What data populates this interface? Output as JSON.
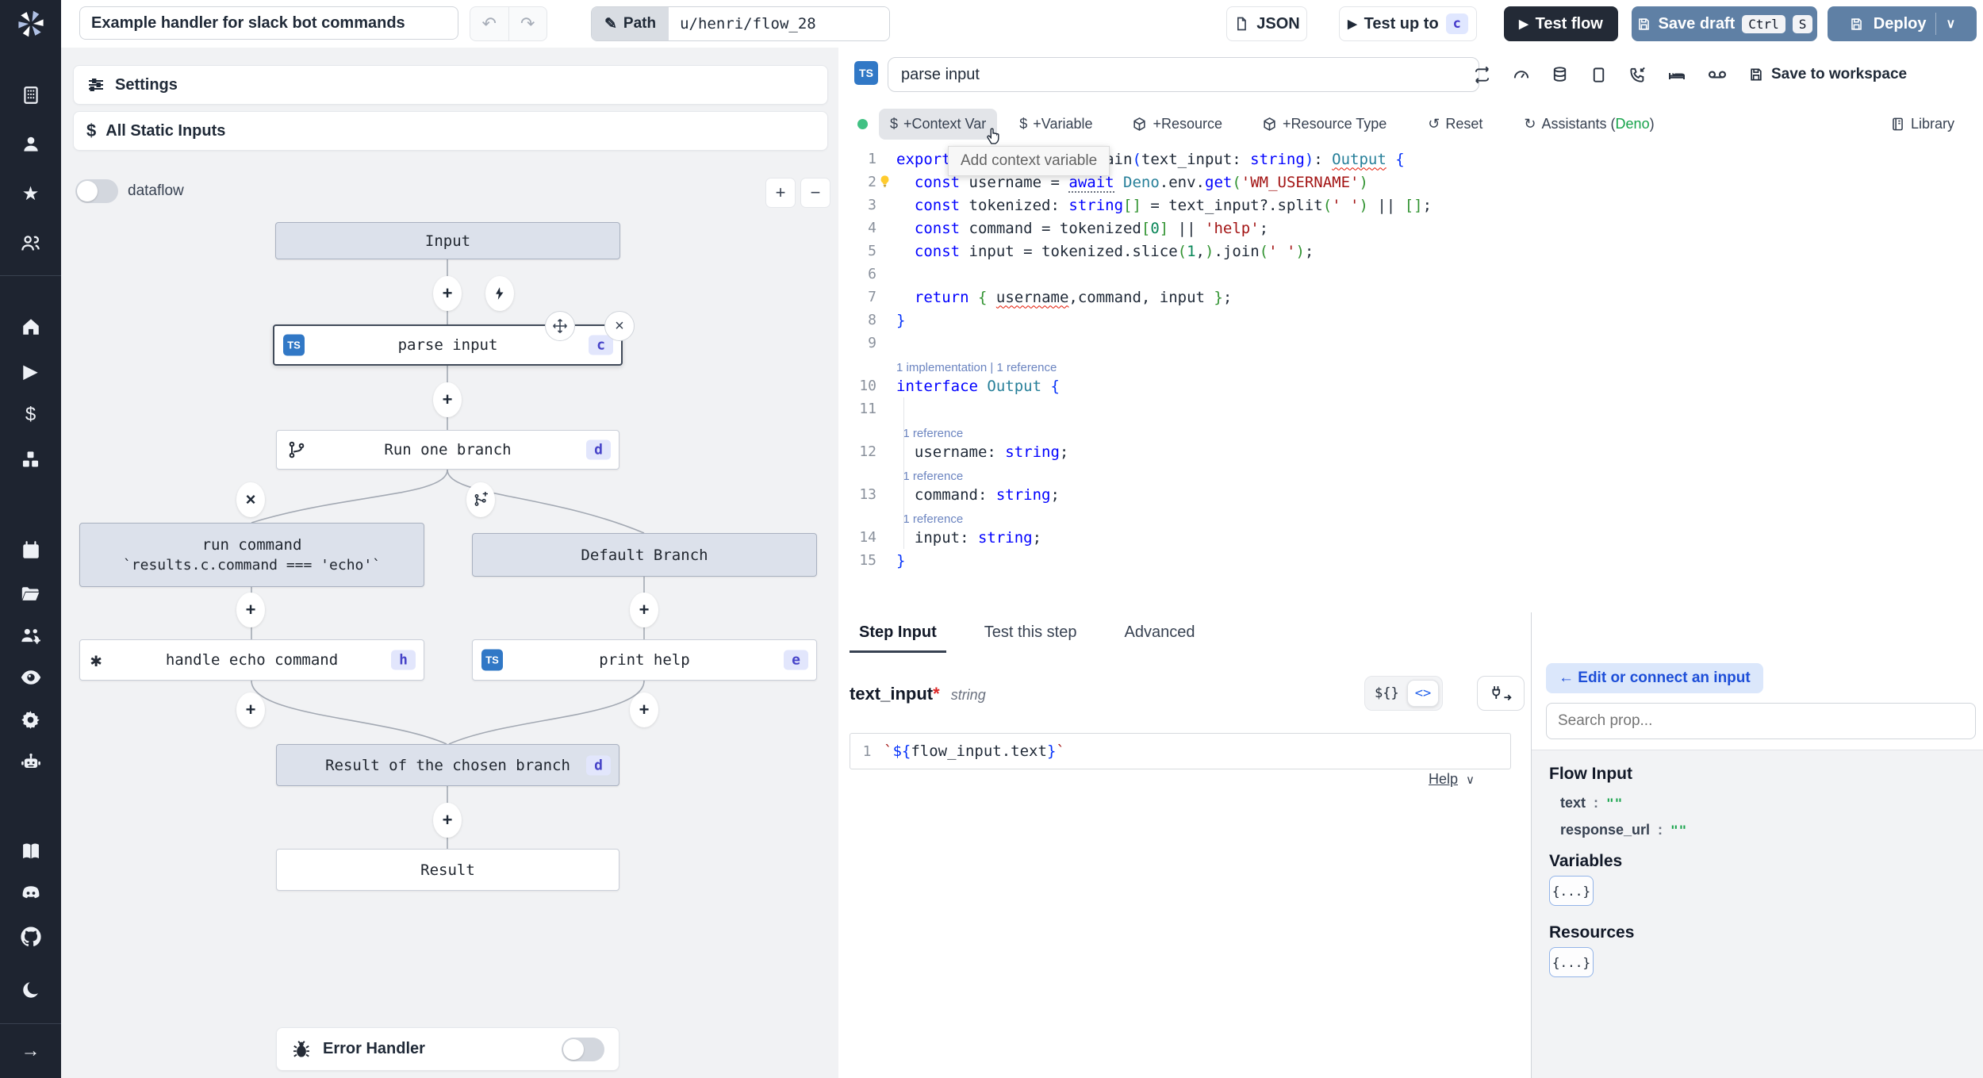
{
  "topbar": {
    "title_value": "Example handler for slack bot commands",
    "path_label": "Path",
    "path_value": "u/henri/flow_28",
    "json_label": "JSON",
    "test_up_to_label": "Test up to",
    "test_up_to_step": "c",
    "test_flow_label": "Test flow",
    "save_draft_label": "Save draft",
    "kbd_ctrl": "Ctrl",
    "kbd_s": "S",
    "deploy_label": "Deploy"
  },
  "flow": {
    "settings_label": "Settings",
    "static_inputs_label": "All Static Inputs",
    "dataflow_label": "dataflow",
    "zoom_in_label": "+",
    "zoom_out_label": "−",
    "input_node": "Input",
    "parse_input": {
      "lang": "TS",
      "label": "parse input",
      "badge": "c"
    },
    "run_one_branch": {
      "label": "Run one branch",
      "badge": "d"
    },
    "run_command": {
      "title": "run command",
      "condition": "`results.c.command === 'echo'`"
    },
    "default_branch": "Default Branch",
    "handle_echo": {
      "label": "handle echo command",
      "badge": "h"
    },
    "print_help": {
      "lang": "TS",
      "label": "print help",
      "badge": "e"
    },
    "result_branch": {
      "label": "Result of the chosen branch",
      "badge": "d"
    },
    "result_node": "Result",
    "error_handler_label": "Error Handler"
  },
  "editor": {
    "lang_badge": "TS",
    "step_name_value": "parse input",
    "save_to_workspace_label": "Save to workspace",
    "add_context_var": "+Context Var",
    "add_variable": "+Variable",
    "add_resource": "+Resource",
    "add_resource_type": "+Resource Type",
    "reset_label": "Reset",
    "assistants_prefix": "Assistants (",
    "assistants_lang": "Deno",
    "assistants_suffix": ")",
    "library_label": "Library",
    "tooltip": "Add context variable",
    "code": [
      {
        "l": "1",
        "t": [
          [
            "kw",
            "export "
          ],
          [
            "kw",
            "async "
          ],
          [
            "kw",
            "function "
          ],
          [
            "pl",
            "main"
          ],
          [
            "b1",
            "("
          ],
          [
            "pl",
            "text_input"
          ],
          [
            "pl",
            ": "
          ],
          [
            "kw",
            "string"
          ],
          [
            "b1",
            ")"
          ],
          [
            "pl",
            ": "
          ],
          [
            "typesq",
            "Output"
          ],
          [
            "pl",
            " "
          ],
          [
            "b1",
            "{"
          ]
        ]
      },
      {
        "l": "2",
        "bulb": true,
        "t": [
          [
            "pl",
            "  "
          ],
          [
            "kw",
            "const "
          ],
          [
            "pl",
            "username"
          ],
          [
            "pl",
            " = "
          ],
          [
            "kwdots",
            "await"
          ],
          [
            "pl",
            " "
          ],
          [
            "type",
            "Deno"
          ],
          [
            "pl",
            ".env."
          ],
          [
            "kw",
            "get"
          ],
          [
            "b2",
            "("
          ],
          [
            "str",
            "'WM_USERNAME'"
          ],
          [
            "b2",
            ")"
          ]
        ]
      },
      {
        "l": "3",
        "t": [
          [
            "pl",
            "  "
          ],
          [
            "kw",
            "const "
          ],
          [
            "pl",
            "tokenized"
          ],
          [
            "pl",
            ": "
          ],
          [
            "kw",
            "string"
          ],
          [
            "b2",
            "[]"
          ],
          [
            "pl",
            " = text_input?.split"
          ],
          [
            "b2",
            "("
          ],
          [
            "str",
            "' '"
          ],
          [
            "b2",
            ")"
          ],
          [
            "pl",
            " || "
          ],
          [
            "b2",
            "[]"
          ],
          [
            "pl",
            ";"
          ]
        ]
      },
      {
        "l": "4",
        "t": [
          [
            "pl",
            "  "
          ],
          [
            "kw",
            "const "
          ],
          [
            "pl",
            "command = tokenized"
          ],
          [
            "b2",
            "["
          ],
          [
            "num",
            "0"
          ],
          [
            "b2",
            "]"
          ],
          [
            "pl",
            " || "
          ],
          [
            "str",
            "'help'"
          ],
          [
            "pl",
            ";"
          ]
        ]
      },
      {
        "l": "5",
        "t": [
          [
            "pl",
            "  "
          ],
          [
            "kw",
            "const "
          ],
          [
            "pl",
            "input = tokenized.slice"
          ],
          [
            "b2",
            "("
          ],
          [
            "num",
            "1"
          ],
          [
            "pl",
            ","
          ],
          [
            "b2",
            ")"
          ],
          [
            "pl",
            ".join"
          ],
          [
            "b2",
            "("
          ],
          [
            "str",
            "' '"
          ],
          [
            "b2",
            ")"
          ],
          [
            "pl",
            ";"
          ]
        ]
      },
      {
        "l": "6",
        "t": []
      },
      {
        "l": "7",
        "t": [
          [
            "pl",
            "  "
          ],
          [
            "kw",
            "return "
          ],
          [
            "b2",
            "{"
          ],
          [
            "pl",
            " "
          ],
          [
            "sq",
            "username"
          ],
          [
            "pl",
            ",command, input "
          ],
          [
            "b2",
            "}"
          ],
          [
            "pl",
            ";"
          ]
        ]
      },
      {
        "l": "8",
        "t": [
          [
            "b1",
            "}"
          ]
        ]
      },
      {
        "l": "9",
        "t": []
      },
      {
        "lens": "1 implementation | 1 reference"
      },
      {
        "l": "10",
        "t": [
          [
            "kw",
            "interface "
          ],
          [
            "type",
            "Output"
          ],
          [
            "pl",
            " "
          ],
          [
            "b1",
            "{"
          ]
        ]
      },
      {
        "l": "11",
        "guide": true,
        "t": []
      },
      {
        "lens": "  1 reference",
        "guide": true
      },
      {
        "l": "12",
        "guide": true,
        "t": [
          [
            "pl",
            "  username"
          ],
          [
            "pl",
            ": "
          ],
          [
            "kw",
            "string"
          ],
          [
            "pl",
            ";"
          ]
        ]
      },
      {
        "lens": "  1 reference",
        "guide": true
      },
      {
        "l": "13",
        "guide": true,
        "t": [
          [
            "pl",
            "  command"
          ],
          [
            "pl",
            ": "
          ],
          [
            "kw",
            "string"
          ],
          [
            "pl",
            ";"
          ]
        ]
      },
      {
        "lens": "  1 reference",
        "guide": true
      },
      {
        "l": "14",
        "guide": true,
        "t": [
          [
            "pl",
            "  input"
          ],
          [
            "pl",
            ": "
          ],
          [
            "kw",
            "string"
          ],
          [
            "pl",
            ";"
          ]
        ]
      },
      {
        "l": "15",
        "t": [
          [
            "b1",
            "}"
          ]
        ]
      }
    ]
  },
  "step": {
    "tabs": [
      "Step Input",
      "Test this step",
      "Advanced"
    ],
    "field_name": "text_input",
    "required": "*",
    "field_type": "string",
    "toggle_template": "${}",
    "toggle_code": "<>",
    "expr_line": "1",
    "expr_tokens": [
      [
        "str",
        "`"
      ],
      [
        "b1",
        "${"
      ],
      [
        "pl",
        "flow_input.text"
      ],
      [
        "b1",
        "}"
      ],
      [
        "str",
        "`"
      ]
    ],
    "help_label": "Help"
  },
  "connect": {
    "back_label": "← Edit or connect an input",
    "search_placeholder": "Search prop...",
    "flow_input_title": "Flow Input",
    "props": [
      {
        "name": "text",
        "value": "\"\""
      },
      {
        "name": "response_url",
        "value": "\"\""
      }
    ],
    "variables_title": "Variables",
    "variables_chip": "{...}",
    "resources_title": "Resources",
    "resources_chip": "{...}"
  }
}
